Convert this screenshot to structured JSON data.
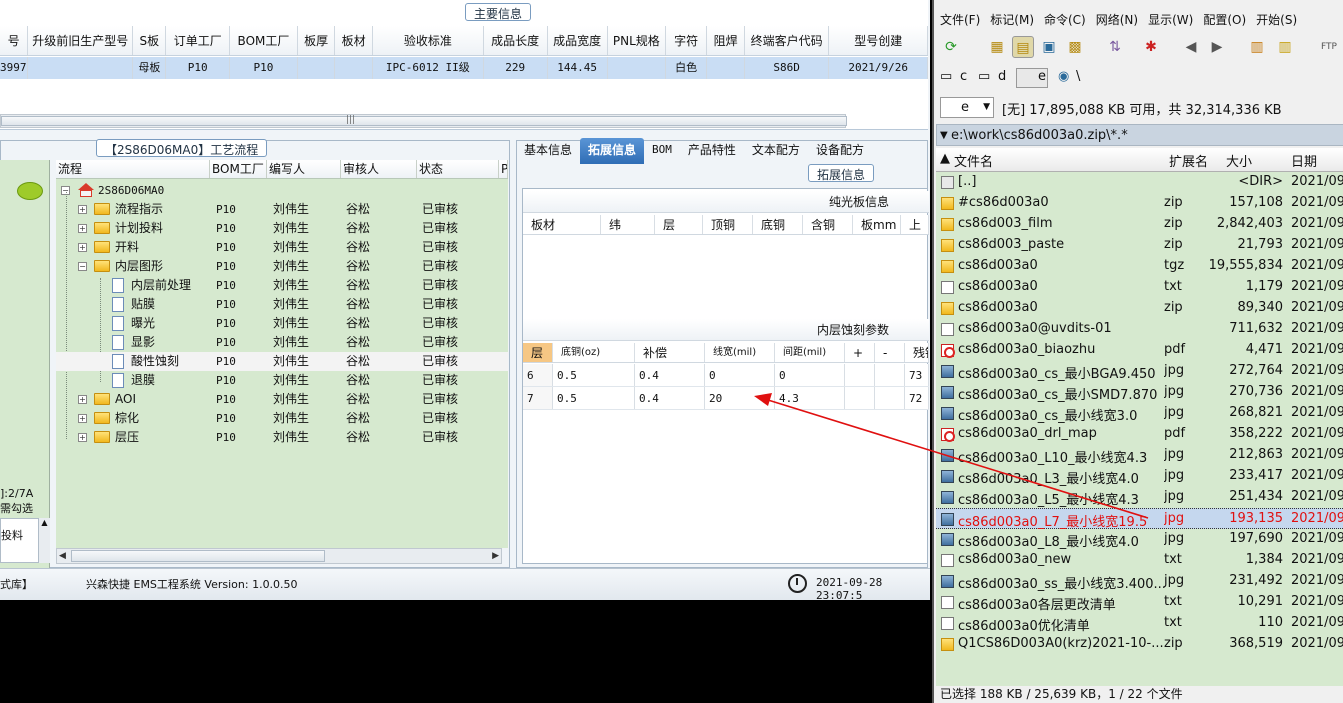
{
  "ems": {
    "main_section_title": "主要信息",
    "top_headers": [
      "号",
      "升级前旧生产型号",
      "S板",
      "订单工厂",
      "BOM工厂",
      "板厚",
      "板材",
      "验收标准",
      "成品长度",
      "成品宽度",
      "PNL规格",
      "字符",
      "阻焊",
      "终端客户代码",
      "型号创建"
    ],
    "top_row": [
      "3997",
      "",
      "母板",
      "P10",
      "P10",
      "",
      "",
      "IPC-6012 II级",
      "229",
      "144.45",
      "",
      "白色",
      "",
      "S86D",
      "2021/9/26"
    ],
    "flow_title": "【2S86D06MA0】工艺流程",
    "left_strip": {
      "line1": "]:2/7A",
      "line2": "需勾选",
      "mini": "投料"
    },
    "tree_headers": [
      "流程",
      "BOM工厂",
      "编写人",
      "审核人",
      "状态",
      "P"
    ],
    "tree_root": "2S86D06MA0",
    "tree_rows": [
      {
        "label": "流程指示",
        "bom": "P10",
        "editor": "刘伟生",
        "reviewer": "谷松",
        "status": "已审核"
      },
      {
        "label": "计划投料",
        "bom": "P10",
        "editor": "刘伟生",
        "reviewer": "谷松",
        "status": "已审核"
      },
      {
        "label": "开料",
        "bom": "P10",
        "editor": "刘伟生",
        "reviewer": "谷松",
        "status": "已审核"
      },
      {
        "label": "内层图形",
        "bom": "P10",
        "editor": "刘伟生",
        "reviewer": "谷松",
        "status": "已审核"
      },
      {
        "label": "内层前处理",
        "bom": "P10",
        "editor": "刘伟生",
        "reviewer": "谷松",
        "status": "已审核"
      },
      {
        "label": "贴膜",
        "bom": "P10",
        "editor": "刘伟生",
        "reviewer": "谷松",
        "status": "已审核"
      },
      {
        "label": "曝光",
        "bom": "P10",
        "editor": "刘伟生",
        "reviewer": "谷松",
        "status": "已审核"
      },
      {
        "label": "显影",
        "bom": "P10",
        "editor": "刘伟生",
        "reviewer": "谷松",
        "status": "已审核"
      },
      {
        "label": "酸性蚀刻",
        "bom": "P10",
        "editor": "刘伟生",
        "reviewer": "谷松",
        "status": "已审核"
      },
      {
        "label": "退膜",
        "bom": "P10",
        "editor": "刘伟生",
        "reviewer": "谷松",
        "status": "已审核"
      },
      {
        "label": "AOI",
        "bom": "P10",
        "editor": "刘伟生",
        "reviewer": "谷松",
        "status": "已审核"
      },
      {
        "label": "棕化",
        "bom": "P10",
        "editor": "刘伟生",
        "reviewer": "谷松",
        "status": "已审核"
      },
      {
        "label": "层压",
        "bom": "P10",
        "editor": "刘伟生",
        "reviewer": "谷松",
        "status": "已审核"
      }
    ],
    "tabs": [
      "基本信息",
      "拓展信息",
      "BOM",
      "产品特性",
      "文本配方",
      "设备配方"
    ],
    "ext_section_title": "拓展信息",
    "light_board_title": "纯光板信息",
    "light_board_headers": [
      "板材",
      "纬",
      "层",
      "顶铜",
      "底铜",
      "含铜",
      "板mm",
      "上"
    ],
    "etch_title": "内层蚀刻参数",
    "etch_headers": [
      "层",
      "底铜(oz)",
      "补偿",
      "线宽(mil)",
      "间距(mil)",
      "+",
      "-",
      "残铜"
    ],
    "etch_rows": [
      [
        "6",
        "0.5",
        "0.4",
        "0",
        "0",
        "",
        "",
        "73"
      ],
      [
        "7",
        "0.5",
        "0.4",
        "20",
        "4.3",
        "",
        "",
        "72"
      ]
    ],
    "status": {
      "lib": "式库】",
      "app": "兴森快捷 EMS工程系统 Version: 1.0.0.50",
      "time": "2021-09-28 23:07:5"
    }
  },
  "fm": {
    "menu": [
      "文件(F)",
      "标记(M)",
      "命令(C)",
      "网络(N)",
      "显示(W)",
      "配置(O)",
      "开始(S)"
    ],
    "drives": [
      "c",
      "d",
      "e",
      "\\"
    ],
    "drive_combo": "e",
    "drive_info": "[无]  17,895,088 KB 可用，共 32,314,336 KB",
    "path": "e:\\work\\cs86d003a0.zip\\*.*",
    "columns": {
      "name": "文件名",
      "ext": "扩展名",
      "size": "大小",
      "date": "日期"
    },
    "files": [
      {
        "icon": "up",
        "name": "[..]",
        "ext": "",
        "size": "<DIR>",
        "date": "2021/09"
      },
      {
        "icon": "zip",
        "name": "#cs86d003a0",
        "ext": "zip",
        "size": "157,108",
        "date": "2021/09"
      },
      {
        "icon": "zip",
        "name": "cs86d003_film",
        "ext": "zip",
        "size": "2,842,403",
        "date": "2021/09"
      },
      {
        "icon": "zip",
        "name": "cs86d003_paste",
        "ext": "zip",
        "size": "21,793",
        "date": "2021/09"
      },
      {
        "icon": "zip",
        "name": "cs86d003a0",
        "ext": "tgz",
        "size": "19,555,834",
        "date": "2021/09"
      },
      {
        "icon": "txt",
        "name": "cs86d003a0",
        "ext": "txt",
        "size": "1,179",
        "date": "2021/09"
      },
      {
        "icon": "zip",
        "name": "cs86d003a0",
        "ext": "zip",
        "size": "89,340",
        "date": "2021/09"
      },
      {
        "icon": "txt",
        "name": "cs86d003a0@uvdits-01",
        "ext": "",
        "size": "711,632",
        "date": "2021/09"
      },
      {
        "icon": "pdf",
        "name": "cs86d003a0_biaozhu",
        "ext": "pdf",
        "size": "4,471",
        "date": "2021/09"
      },
      {
        "icon": "jpg",
        "name": "cs86d003a0_cs_最小BGA9.450",
        "ext": "jpg",
        "size": "272,764",
        "date": "2021/09"
      },
      {
        "icon": "jpg",
        "name": "cs86d003a0_cs_最小SMD7.870",
        "ext": "jpg",
        "size": "270,736",
        "date": "2021/09"
      },
      {
        "icon": "jpg",
        "name": "cs86d003a0_cs_最小线宽3.0",
        "ext": "jpg",
        "size": "268,821",
        "date": "2021/09"
      },
      {
        "icon": "pdf",
        "name": "cs86d003a0_drl_map",
        "ext": "pdf",
        "size": "358,222",
        "date": "2021/09"
      },
      {
        "icon": "jpg",
        "name": "cs86d003a0_L10_最小线宽4.3",
        "ext": "jpg",
        "size": "212,863",
        "date": "2021/09"
      },
      {
        "icon": "jpg",
        "name": "cs86d003a0_L3_最小线宽4.0",
        "ext": "jpg",
        "size": "233,417",
        "date": "2021/09"
      },
      {
        "icon": "jpg",
        "name": "cs86d003a0_L5_最小线宽4.3",
        "ext": "jpg",
        "size": "251,434",
        "date": "2021/09"
      },
      {
        "icon": "jpg",
        "name": "cs86d003a0_L7_最小线宽19.5",
        "ext": "jpg",
        "size": "193,135",
        "date": "2021/09",
        "selected": true
      },
      {
        "icon": "jpg",
        "name": "cs86d003a0_L8_最小线宽4.0",
        "ext": "jpg",
        "size": "197,690",
        "date": "2021/09"
      },
      {
        "icon": "txt",
        "name": "cs86d003a0_new",
        "ext": "txt",
        "size": "1,384",
        "date": "2021/09"
      },
      {
        "icon": "jpg",
        "name": "cs86d003a0_ss_最小线宽3.400...",
        "ext": "jpg",
        "size": "231,492",
        "date": "2021/09"
      },
      {
        "icon": "txt",
        "name": "cs86d003a0各层更改清单",
        "ext": "txt",
        "size": "10,291",
        "date": "2021/09"
      },
      {
        "icon": "txt",
        "name": "cs86d003a0优化清单",
        "ext": "txt",
        "size": "110",
        "date": "2021/09"
      },
      {
        "icon": "zip",
        "name": "Q1CS86D003A0(krz)2021-10-...",
        "ext": "zip",
        "size": "368,519",
        "date": "2021/09"
      }
    ],
    "status": "已选择 188 KB / 25,639 KB，1 / 22 个文件"
  },
  "colors": {
    "grid_green": "#d6e9cf",
    "selection_blue": "#c9ddf4",
    "tab_active": "#2f6db5",
    "annotation_red": "#e01010"
  }
}
